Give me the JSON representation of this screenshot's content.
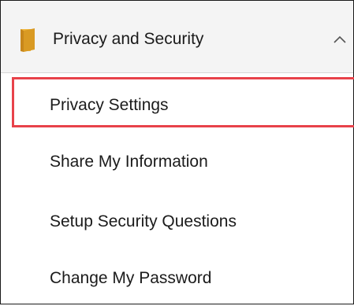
{
  "menu": {
    "section_title": "Privacy and Security",
    "section_icon": "folder-icon",
    "expand_icon": "chevron-up-icon",
    "items": [
      {
        "label": "Privacy Settings",
        "highlighted": true
      },
      {
        "label": "Share My Information",
        "highlighted": false
      },
      {
        "label": "Setup Security Questions",
        "highlighted": false
      },
      {
        "label": "Change My Password",
        "highlighted": false
      }
    ]
  },
  "colors": {
    "folder": "#e1a12a",
    "highlight_border": "#e8424a",
    "header_background": "#f4f4f4"
  }
}
